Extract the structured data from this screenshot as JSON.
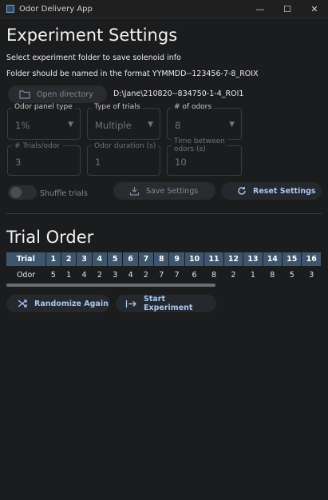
{
  "window": {
    "title": "Odor Delivery App",
    "controls": {
      "minimize": "—",
      "maximize": "☐",
      "close": "✕"
    }
  },
  "settings": {
    "heading": "Experiment Settings",
    "instruction": "Select experiment folder to save solenoid info",
    "format_note": "Folder should be named in the format YYMMDD--123456-7-8_ROIX",
    "open_directory_label": "Open directory",
    "directory_path": "D:\\Jane\\210820--834750-1-4_ROI1",
    "odor_panel": {
      "label": "Odor panel type",
      "value": "1%"
    },
    "trial_type": {
      "label": "Type of trials",
      "value": "Multiple"
    },
    "num_odors": {
      "label": "# of odors",
      "value": "8"
    },
    "trials_per_odor": {
      "label": "# Trials/odor",
      "value": "3"
    },
    "odor_duration": {
      "label": "Odor duration (s)",
      "value": "1"
    },
    "time_between": {
      "label": "Time between odors (s)",
      "value": "10"
    },
    "shuffle_label": "Shuffle trials",
    "shuffle_on": false,
    "save_label": "Save Settings",
    "reset_label": "Reset Settings"
  },
  "trial_order": {
    "heading": "Trial Order",
    "row_label_header": "Trial",
    "row_label": "Odor",
    "trials": [
      "1",
      "2",
      "3",
      "4",
      "5",
      "6",
      "7",
      "8",
      "9",
      "10",
      "11",
      "12",
      "13",
      "14",
      "15",
      "16"
    ],
    "odors": [
      "5",
      "1",
      "4",
      "2",
      "3",
      "4",
      "2",
      "7",
      "7",
      "6",
      "8",
      "2",
      "1",
      "8",
      "5",
      "3"
    ],
    "randomize_label": "Randomize Again",
    "start_label": "Start Experiment"
  },
  "colors": {
    "accent": "#a9c7f0",
    "table_header": "#3d566e",
    "background": "#1b1c1e"
  }
}
